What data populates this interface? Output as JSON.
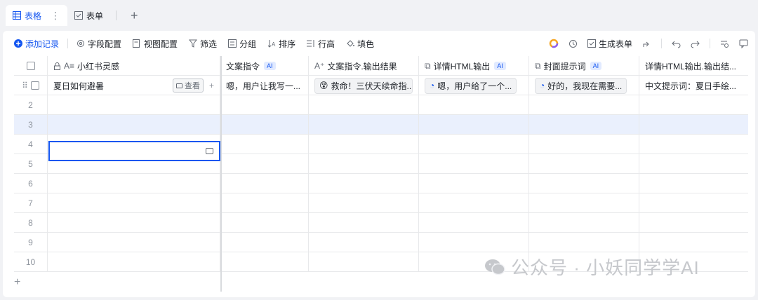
{
  "tabs": [
    {
      "label": "表格",
      "more": "⋮"
    },
    {
      "label": "表单"
    }
  ],
  "toolbar": {
    "add_record": "添加记录",
    "field_config": "字段配置",
    "view_config": "视图配置",
    "filter": "筛选",
    "group": "分组",
    "sort": "排序",
    "row_height": "行高",
    "fill_color": "填色",
    "generate_form": "生成表单"
  },
  "columns": [
    {
      "label": "小红书灵感",
      "ai": false
    },
    {
      "label": "文案指令",
      "ai": true
    },
    {
      "label": "文案指令.输出结果",
      "ai": false
    },
    {
      "label": "详情HTML输出",
      "ai": true
    },
    {
      "label": "封面提示词",
      "ai": true
    },
    {
      "label": "详情HTML输出.输出结...",
      "ai": false
    }
  ],
  "ai_badge": "AI",
  "rows": [
    {
      "num": "",
      "c1": "夏日如何避暑",
      "view": "查看",
      "c2": "嗯，用户让我写一...",
      "c3": "救命！三伏天续命指...",
      "c4": "嗯，用户给了一个...",
      "c5": "好的，我现在需要...",
      "c6": "中文提示词：夏日手绘..."
    },
    {
      "num": "2"
    },
    {
      "num": "3"
    },
    {
      "num": "4"
    },
    {
      "num": "5"
    },
    {
      "num": "6"
    },
    {
      "num": "7"
    },
    {
      "num": "8"
    },
    {
      "num": "9"
    },
    {
      "num": "10"
    }
  ],
  "watermark": "公众号 · 小妖同学学AI",
  "colors": {
    "accent": "#1456f0",
    "selected_row": "#eaf0fd"
  }
}
